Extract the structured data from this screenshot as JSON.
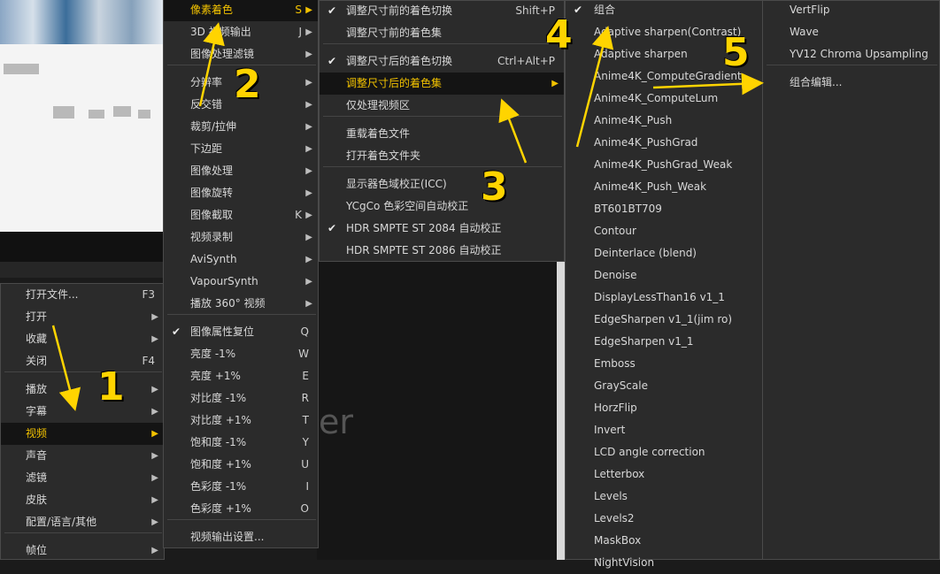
{
  "colors": {
    "accent": "#f2c200",
    "annotation": "#ffd400",
    "menu_bg": "#2b2b2b"
  },
  "background": {
    "watermark_text": "er"
  },
  "menu1": {
    "items": [
      {
        "label": "打开文件...",
        "shortcut": "F3"
      },
      {
        "label": "打开",
        "submenu": true
      },
      {
        "label": "收藏",
        "submenu": true
      },
      {
        "label": "关闭",
        "shortcut": "F4"
      },
      {
        "label": "播放",
        "submenu": true
      },
      {
        "label": "字幕",
        "submenu": true
      },
      {
        "label": "视频",
        "submenu": true,
        "active": true
      },
      {
        "label": "声音",
        "submenu": true
      },
      {
        "label": "滤镜",
        "submenu": true
      },
      {
        "label": "皮肤",
        "submenu": true
      },
      {
        "label": "配置/语言/其他",
        "submenu": true
      },
      {
        "label": "帧位",
        "submenu": true
      }
    ]
  },
  "menu2": {
    "items": [
      {
        "label": "像素着色",
        "shortcut": "S",
        "submenu": true,
        "active": true
      },
      {
        "label": "3D 视频输出",
        "shortcut": "J",
        "submenu": true
      },
      {
        "label": "图像处理滤镜",
        "submenu": true
      },
      {
        "label": "分辨率",
        "submenu": true
      },
      {
        "label": "反交错",
        "submenu": true
      },
      {
        "label": "裁剪/拉伸",
        "submenu": true
      },
      {
        "label": "下边距",
        "submenu": true
      },
      {
        "label": "图像处理",
        "submenu": true
      },
      {
        "label": "图像旋转",
        "submenu": true
      },
      {
        "label": "图像截取",
        "shortcut": "K",
        "submenu": true
      },
      {
        "label": "视频录制",
        "submenu": true
      },
      {
        "label": "AviSynth",
        "submenu": true
      },
      {
        "label": "VapourSynth",
        "submenu": true
      },
      {
        "label": "播放 360° 视频",
        "submenu": true
      },
      {
        "label": "图像属性复位",
        "shortcut": "Q",
        "checked": true
      },
      {
        "label": "亮度 -1%",
        "shortcut": "W"
      },
      {
        "label": "亮度 +1%",
        "shortcut": "E"
      },
      {
        "label": "对比度 -1%",
        "shortcut": "R"
      },
      {
        "label": "对比度 +1%",
        "shortcut": "T"
      },
      {
        "label": "饱和度 -1%",
        "shortcut": "Y"
      },
      {
        "label": "饱和度 +1%",
        "shortcut": "U"
      },
      {
        "label": "色彩度 -1%",
        "shortcut": "I"
      },
      {
        "label": "色彩度 +1%",
        "shortcut": "O"
      },
      {
        "label": "视频输出设置..."
      }
    ]
  },
  "menu3": {
    "items": [
      {
        "label": "调整尺寸前的着色切换",
        "shortcut": "Shift+P",
        "checked": true
      },
      {
        "label": "调整尺寸前的着色集"
      },
      {
        "label": "调整尺寸后的着色切换",
        "shortcut": "Ctrl+Alt+P",
        "checked": true
      },
      {
        "label": "调整尺寸后的着色集",
        "submenu": true,
        "active": true
      },
      {
        "label": "仅处理视频区"
      },
      {
        "label": "重载着色文件"
      },
      {
        "label": "打开着色文件夹"
      },
      {
        "label": "显示器色域校正(ICC)"
      },
      {
        "label": "YCgCo 色彩空间自动校正"
      },
      {
        "label": "HDR SMPTE ST 2084 自动校正",
        "checked": true
      },
      {
        "label": "HDR SMPTE ST 2086 自动校正"
      }
    ]
  },
  "menu4": {
    "items": [
      {
        "label": "组合",
        "checked": true
      },
      {
        "label": "Adaptive sharpen(Contrast)"
      },
      {
        "label": "Adaptive sharpen"
      },
      {
        "label": "Anime4K_ComputeGradient"
      },
      {
        "label": "Anime4K_ComputeLum"
      },
      {
        "label": "Anime4K_Push"
      },
      {
        "label": "Anime4K_PushGrad"
      },
      {
        "label": "Anime4K_PushGrad_Weak"
      },
      {
        "label": "Anime4K_Push_Weak"
      },
      {
        "label": "BT601BT709"
      },
      {
        "label": "Contour"
      },
      {
        "label": "Deinterlace (blend)"
      },
      {
        "label": "Denoise"
      },
      {
        "label": "DisplayLessThan16 v1_1"
      },
      {
        "label": "EdgeSharpen v1_1(jim ro)"
      },
      {
        "label": "EdgeSharpen v1_1"
      },
      {
        "label": "Emboss"
      },
      {
        "label": "GrayScale"
      },
      {
        "label": "HorzFlip"
      },
      {
        "label": "Invert"
      },
      {
        "label": "LCD angle correction"
      },
      {
        "label": "Letterbox"
      },
      {
        "label": "Levels"
      },
      {
        "label": "Levels2"
      },
      {
        "label": "MaskBox"
      },
      {
        "label": "NightVision"
      }
    ]
  },
  "menu5": {
    "items": [
      {
        "label": "VertFlip"
      },
      {
        "label": "Wave"
      },
      {
        "label": "YV12 Chroma Upsampling"
      },
      {
        "label": "组合编辑..."
      }
    ]
  },
  "annotations": {
    "n1": "1",
    "n2": "2",
    "n3": "3",
    "n4": "4",
    "n5": "5"
  }
}
